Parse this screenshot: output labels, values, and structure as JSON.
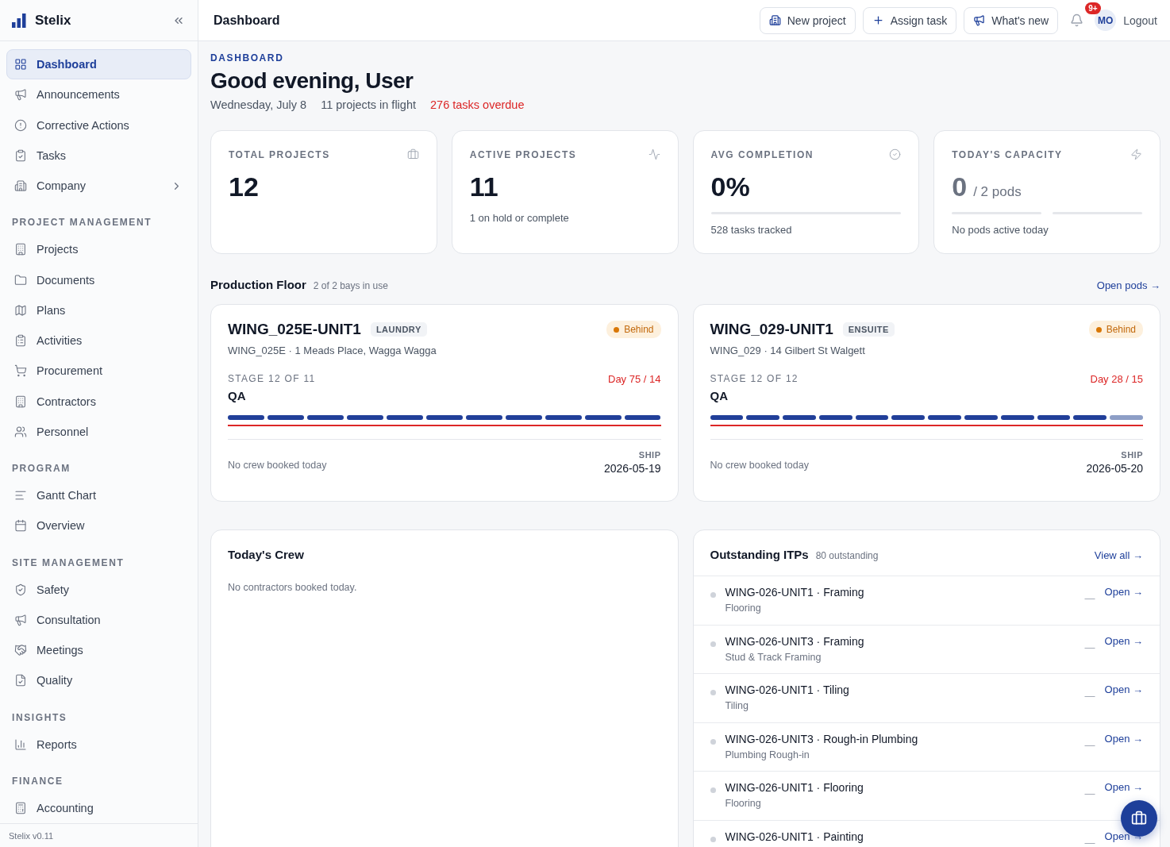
{
  "sidebar": {
    "brand": "Stelix",
    "sections": [
      {
        "items": [
          {
            "label": "Dashboard",
            "selected": true,
            "submenu": false
          },
          {
            "label": "Announcements",
            "selected": false,
            "submenu": false
          },
          {
            "label": "Corrective Actions",
            "selected": false,
            "submenu": false
          },
          {
            "label": "Tasks",
            "selected": false,
            "submenu": false
          },
          {
            "label": "Company",
            "selected": false,
            "submenu": true
          }
        ]
      },
      {
        "title": "PROJECT MANAGEMENT",
        "items": [
          {
            "label": "Projects",
            "selected": false,
            "submenu": false
          },
          {
            "label": "Documents",
            "selected": false,
            "submenu": false
          },
          {
            "label": "Plans",
            "selected": false,
            "submenu": false
          },
          {
            "label": "Activities",
            "selected": false,
            "submenu": false
          },
          {
            "label": "Procurement",
            "selected": false,
            "submenu": false
          },
          {
            "label": "Contractors",
            "selected": false,
            "submenu": false
          },
          {
            "label": "Personnel",
            "selected": false,
            "submenu": false
          }
        ]
      },
      {
        "title": "PROGRAM",
        "items": [
          {
            "label": "Gantt Chart",
            "selected": false,
            "submenu": false
          },
          {
            "label": "Overview",
            "selected": false,
            "submenu": false
          }
        ]
      },
      {
        "title": "SITE MANAGEMENT",
        "items": [
          {
            "label": "Safety",
            "selected": false,
            "submenu": false
          },
          {
            "label": "Consultation",
            "selected": false,
            "submenu": false
          },
          {
            "label": "Meetings",
            "selected": false,
            "submenu": false
          },
          {
            "label": "Quality",
            "selected": false,
            "submenu": false
          }
        ]
      },
      {
        "title": "INSIGHTS",
        "items": [
          {
            "label": "Reports",
            "selected": false,
            "submenu": false
          }
        ]
      },
      {
        "title": "FINANCE",
        "items": [
          {
            "label": "Accounting",
            "selected": false,
            "submenu": false
          }
        ]
      }
    ],
    "version": "Stelix v0.11"
  },
  "header": {
    "title": "Dashboard",
    "actions": [
      "New project",
      "Assign task",
      "What's new"
    ],
    "notifications": "9+",
    "avatar": "MO",
    "logout": "Logout"
  },
  "hero": {
    "eyebrow": "DASHBOARD",
    "greeting": "Good evening, User",
    "date": "Wednesday, July 8",
    "projects": "11 projects in flight",
    "overdue": "276 tasks overdue"
  },
  "stats": [
    {
      "label": "TOTAL PROJECTS",
      "value": "12"
    },
    {
      "label": "ACTIVE PROJECTS",
      "value": "11",
      "note": "1 on hold or complete"
    },
    {
      "label": "AVG COMPLETION",
      "value": "0%",
      "level": 0,
      "note": "528 tasks tracked"
    },
    {
      "label": "TODAY'S CAPACITY",
      "value": "0",
      "unit": "/ 2 pods",
      "pods": [
        {
          "active": false
        },
        {
          "active": false
        }
      ],
      "note": "No pods active today"
    }
  ],
  "floor": {
    "title": "Production Floor",
    "subtitle": "2 of 2 bays in use",
    "link": "Open pods →",
    "pods": [
      {
        "name": "WING_025E-UNIT1",
        "tag": "LAUNDRY",
        "status": "Behind",
        "address": "WING_025E · 1 Meads Place, Wagga Wagga",
        "stage": "STAGE 12 OF 11",
        "day": "Day 75 / 14",
        "overdue": true,
        "phase": "QA",
        "segments": [
          {
            "done": true
          },
          {
            "done": true
          },
          {
            "done": true
          },
          {
            "done": true
          },
          {
            "done": true
          },
          {
            "done": true
          },
          {
            "done": true
          },
          {
            "done": true
          },
          {
            "done": true
          },
          {
            "done": true
          },
          {
            "done": true
          }
        ],
        "crew": "No crew booked today",
        "ship_label": "SHIP",
        "ship": "2026-05-19"
      },
      {
        "name": "WING_029-UNIT1",
        "tag": "ENSUITE",
        "status": "Behind",
        "address": "WING_029 · 14 Gilbert St Walgett",
        "stage": "STAGE 12 OF 12",
        "day": "Day 28 / 15",
        "overdue": true,
        "phase": "QA",
        "segments": [
          {
            "done": true
          },
          {
            "done": true
          },
          {
            "done": true
          },
          {
            "done": true
          },
          {
            "done": true
          },
          {
            "done": true
          },
          {
            "done": true
          },
          {
            "done": true
          },
          {
            "done": true
          },
          {
            "done": true
          },
          {
            "done": true
          },
          {
            "done": false
          }
        ],
        "crew": "No crew booked today",
        "ship_label": "SHIP",
        "ship": "2026-05-20"
      }
    ]
  },
  "crew": {
    "title": "Today's Crew",
    "empty": "No contractors booked today."
  },
  "itps": {
    "title": "Outstanding ITPs",
    "count": "80 outstanding",
    "link": "View all →",
    "rows": [
      {
        "title": "WING-026-UNIT1 · Framing",
        "subtitle": "Flooring",
        "status": "—",
        "action": "Open →"
      },
      {
        "title": "WING-026-UNIT3 · Framing",
        "subtitle": "Stud & Track Framing",
        "status": "—",
        "action": "Open →"
      },
      {
        "title": "WING-026-UNIT1 · Tiling",
        "subtitle": "Tiling",
        "status": "—",
        "action": "Open →"
      },
      {
        "title": "WING-026-UNIT3 · Rough-in Plumbing",
        "subtitle": "Plumbing Rough-in",
        "status": "—",
        "action": "Open →"
      },
      {
        "title": "WING-026-UNIT1 · Flooring",
        "subtitle": "Flooring",
        "status": "—",
        "action": "Open →"
      },
      {
        "title": "WING-026-UNIT1 · Painting",
        "status": "—",
        "action": "Open →"
      }
    ]
  }
}
